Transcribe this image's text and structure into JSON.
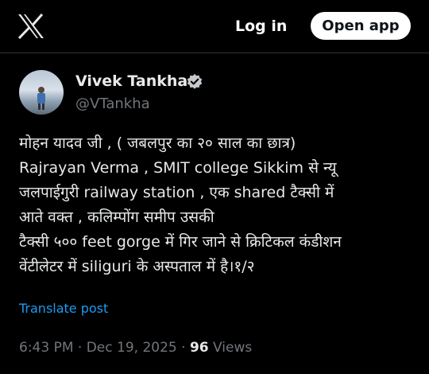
{
  "header": {
    "logo_icon": "x-logo-icon",
    "login_label": "Log in",
    "open_app_label": "Open app"
  },
  "post": {
    "author_name": "Vivek Tankha",
    "author_handle": "@VTankha",
    "verified_icon": "verified-badge-icon",
    "verified_color": "#c5c8cc",
    "body_lines": [
      "मोहन यादव जी , ( जबलपुर का २० साल का छात्र)",
      "Rajrayan Verma , SMIT college Sikkim से न्यू",
      "जलपाईगुरी railway station , एक shared टैक्सी में",
      "आते वक्त , कलिम्पोंग समीप उसकी",
      "टैक्सी ५०० feet gorge में गिर जाने से क्रिटिकल कंडीशन",
      "वेंटीलेटर में siliguri के अस्पताल में है।१/२"
    ],
    "translate_label": "Translate post",
    "time": "6:43 PM",
    "date": "Dec 19, 2025",
    "separator": "·",
    "views_count": "96",
    "views_label": "Views"
  },
  "colors": {
    "background": "#000000",
    "text": "#e7e9ea",
    "muted": "#71767b",
    "link": "#1d9bf0"
  }
}
